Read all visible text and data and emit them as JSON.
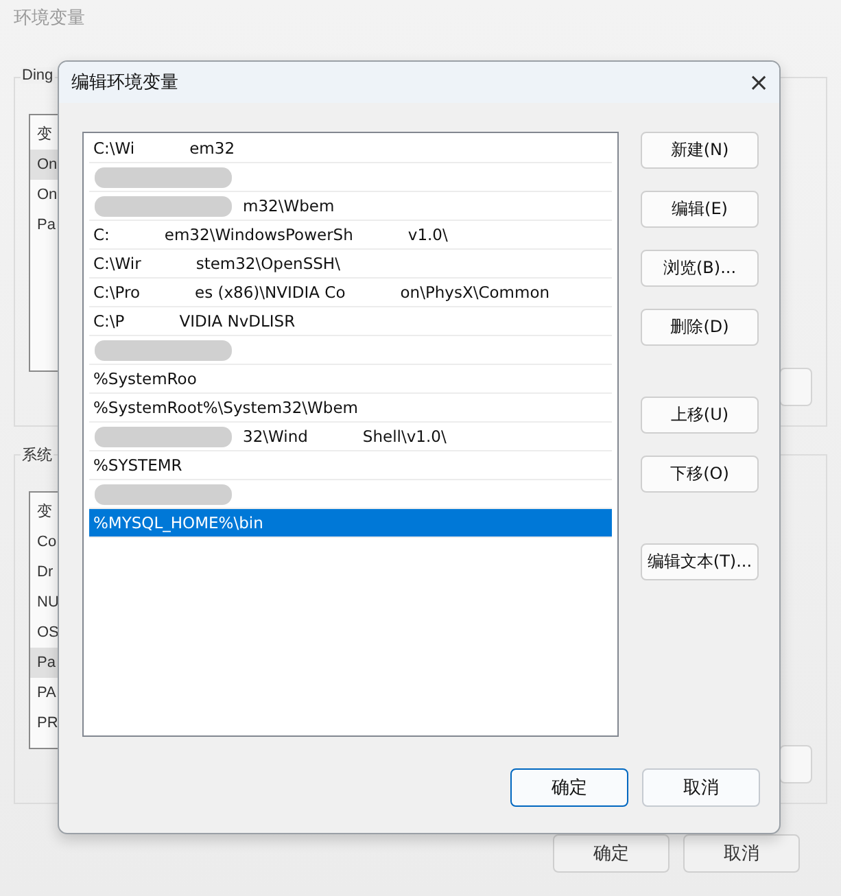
{
  "background_window": {
    "title": "环境变量",
    "user_group": {
      "label": "Ding",
      "rows": [
        {
          "text": "变",
          "selected": false
        },
        {
          "text": "On",
          "selected": true
        },
        {
          "text": "On",
          "selected": false
        },
        {
          "text": "Pa",
          "selected": false
        }
      ]
    },
    "system_group": {
      "label": "系统",
      "rows": [
        {
          "text": "变",
          "selected": false
        },
        {
          "text": "Co",
          "selected": false
        },
        {
          "text": "Dr",
          "selected": false
        },
        {
          "text": "NU",
          "selected": false
        },
        {
          "text": "OS",
          "selected": false
        },
        {
          "text": "Pa",
          "selected": true
        },
        {
          "text": "PA",
          "selected": false
        },
        {
          "text": "PR",
          "selected": false
        }
      ]
    },
    "buttons": [
      "确定",
      "取消"
    ]
  },
  "dialog": {
    "title": "编辑环境变量",
    "close": "×",
    "paths": [
      {
        "segments": [
          "C:\\Wi",
          "em32"
        ],
        "masked_start": false,
        "selected": false
      },
      {
        "masked_start": true,
        "selected": false
      },
      {
        "segments": [
          "m32\\Wbem"
        ],
        "masked_start": true,
        "selected": false
      },
      {
        "segments": [
          "C:",
          "em32\\WindowsPowerSh",
          "v1.0\\"
        ],
        "masked_start": false,
        "selected": false
      },
      {
        "segments": [
          "C:\\Wir",
          "stem32\\OpenSSH\\"
        ],
        "masked_start": false,
        "selected": false
      },
      {
        "segments": [
          "C:\\Pro",
          "es (x86)\\NVIDIA Co",
          "on\\PhysX\\Common"
        ],
        "masked_start": false,
        "selected": false
      },
      {
        "segments": [
          "C:\\P",
          "VIDIA NvDLISR"
        ],
        "masked_start": false,
        "selected": false
      },
      {
        "masked_start": true,
        "selected": false
      },
      {
        "segments": [
          "%SystemRoo"
        ],
        "masked_start": false,
        "selected": false
      },
      {
        "segments": [
          "%SystemRoot%\\System32\\Wbem"
        ],
        "masked_start": false,
        "selected": false
      },
      {
        "segments": [
          "32\\Wind",
          "Shell\\v1.0\\"
        ],
        "masked_start": true,
        "selected": false
      },
      {
        "segments": [
          "%SYSTEMR"
        ],
        "masked_start": false,
        "selected": false
      },
      {
        "masked_start": true,
        "selected": false
      },
      {
        "segments": [
          "%MYSQL_HOME%\\bin"
        ],
        "masked_start": false,
        "selected": true
      }
    ],
    "side_buttons": [
      "新建(N)",
      "编辑(E)",
      "浏览(B)...",
      "删除(D)",
      "上移(U)",
      "下移(O)",
      "编辑文本(T)..."
    ],
    "buttons": [
      {
        "label": "确定",
        "default": true
      },
      {
        "label": "取消",
        "default": false
      }
    ]
  }
}
